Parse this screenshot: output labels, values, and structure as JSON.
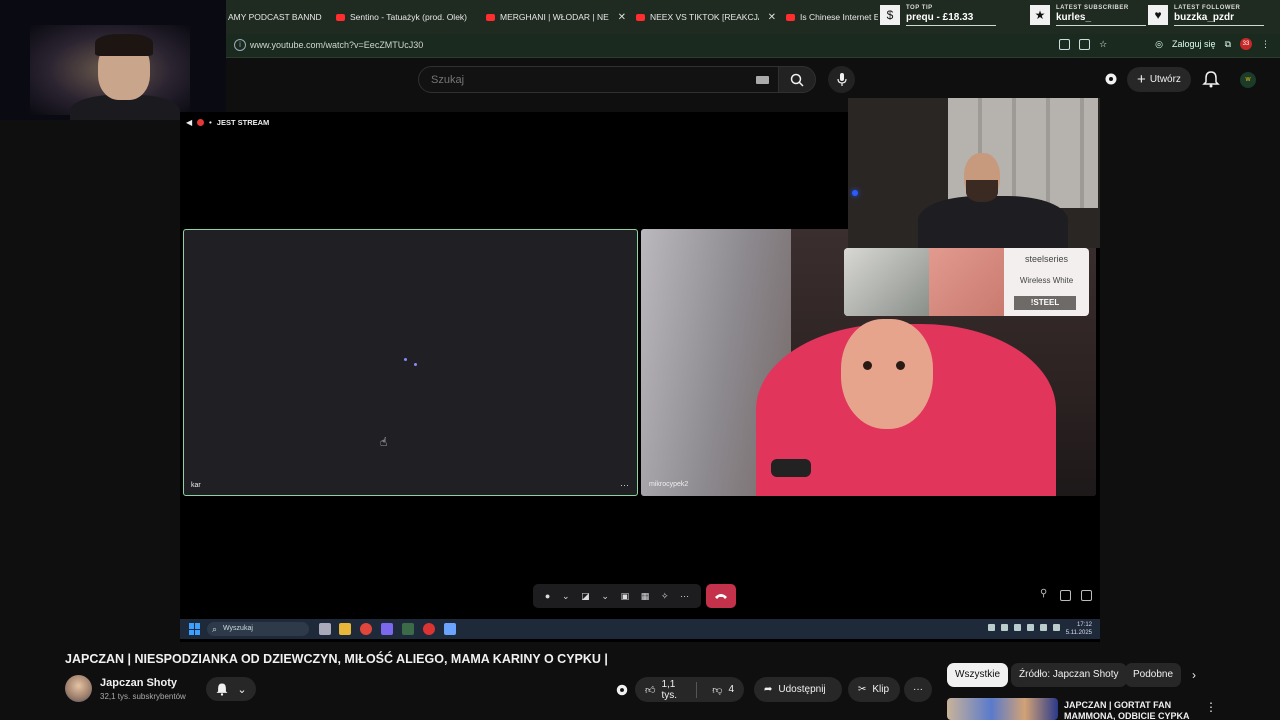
{
  "browser": {
    "tabs": [
      {
        "label": "AMY PODCAST BANND",
        "youtube": false
      },
      {
        "label": "Sentino - Tatuażyk (prod. Olek)",
        "youtube": true
      },
      {
        "label": "MERGHANI | WŁODAR | NEEX |",
        "youtube": true
      },
      {
        "label": "NEEX VS TIKTOK [REAKCJA NA",
        "youtube": true
      },
      {
        "label": "Is Chinese Internet Ev",
        "youtube": true
      }
    ],
    "url": "www.youtube.com/watch?v=EecZMTUcJ30",
    "login_label": "Zaloguj się",
    "notification_count": "33"
  },
  "stream_widgets": {
    "top_tip": {
      "label": "TOP TIP",
      "value": "prequ - £18.33"
    },
    "latest_subscriber": {
      "label": "LATEST SUBSCRIBER",
      "value": "kurles_"
    },
    "latest_follower": {
      "label": "LATEST FOLLOWER",
      "value": "buzzka_pzdr"
    }
  },
  "header": {
    "search_placeholder": "Szukaj",
    "create_label": "Utwórz",
    "avatar_letter": "w"
  },
  "player": {
    "live_label": "JEST STREAM",
    "tile_left_name": "kar",
    "tile_right_name": "mikrocypek2",
    "ad": {
      "brand": "steelseries",
      "product": "Wireless White",
      "cta": "!STEEL"
    },
    "meeting_more": "···"
  },
  "taskbar": {
    "search_placeholder": "Wyszukaj",
    "time": "17:12",
    "date": "5.11.2025"
  },
  "video": {
    "title": "JAPCZAN | NIESPODZIANKA OD DZIEWCZYN, MIŁOŚĆ ALIEGO, MAMA KARINY O CYPKU |",
    "channel_name": "Japczan Shoty",
    "subscribers": "32,1 tys. subskrybentów",
    "likes": "1,1 tys.",
    "dislikes": "4",
    "share_label": "Udostępnij",
    "clip_label": "Klip"
  },
  "chips": [
    {
      "label": "Wszystkie",
      "active": true
    },
    {
      "label": "Źródło: Japczan Shoty",
      "active": false
    },
    {
      "label": "Podobne",
      "active": false
    }
  ],
  "recommendation": {
    "title": "JAPCZAN | GORTAT FAN MAMMONA, ODBICIE CYPKA"
  }
}
